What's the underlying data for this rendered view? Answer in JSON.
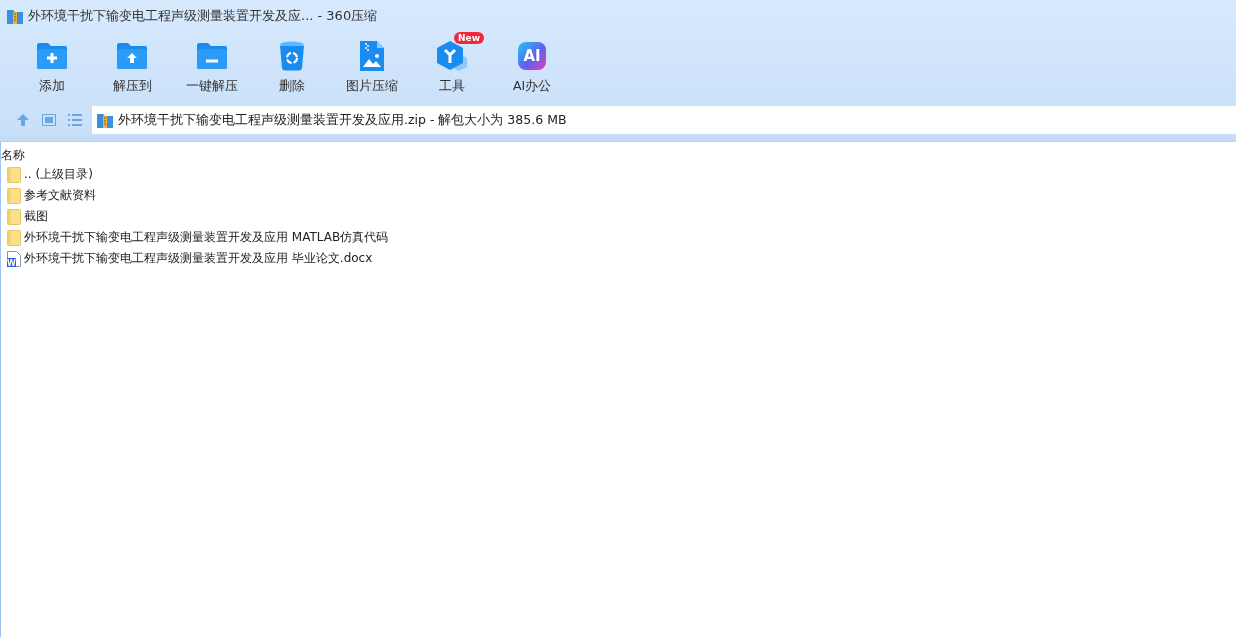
{
  "window": {
    "title": "外环境干扰下输变电工程声级测量装置开发及应... - 360压缩"
  },
  "toolbar": [
    {
      "kind": "add",
      "label": "添加"
    },
    {
      "kind": "extract",
      "label": "解压到"
    },
    {
      "kind": "quick",
      "label": "一键解压"
    },
    {
      "kind": "delete",
      "label": "删除"
    },
    {
      "kind": "image",
      "label": "图片压缩"
    },
    {
      "kind": "tools",
      "label": "工具",
      "badge": "New"
    },
    {
      "kind": "ai",
      "label": "AI办公",
      "icon_text": "AI"
    }
  ],
  "address": {
    "path": "外环境干扰下输变电工程声级测量装置开发及应用.zip - 解包大小为 385.6 MB"
  },
  "list": {
    "columns": [
      "名称"
    ],
    "rows": [
      {
        "kind": "folder",
        "name": ".. (上级目录)"
      },
      {
        "kind": "folder",
        "name": "参考文献资料"
      },
      {
        "kind": "folder",
        "name": "截图"
      },
      {
        "kind": "folder",
        "name": "外环境干扰下输变电工程声级测量装置开发及应用 MATLAB仿真代码"
      },
      {
        "kind": "docx",
        "name": "外环境干扰下输变电工程声级测量装置开发及应用 毕业论文.docx",
        "icon_text": "W"
      }
    ]
  }
}
